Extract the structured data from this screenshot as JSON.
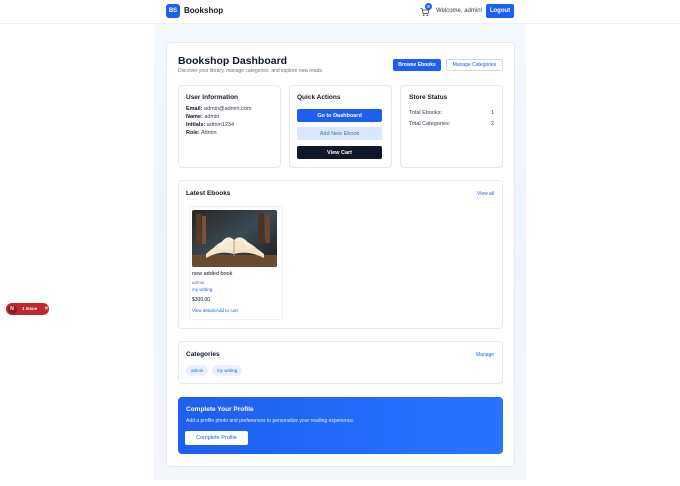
{
  "navbar": {
    "logo_text": "BS",
    "brand": "Bookshop",
    "cart_count": "0",
    "welcome": "Welcome, admin!",
    "logout": "Logout"
  },
  "header": {
    "title": "Bookshop Dashboard",
    "subtitle": "Discover your library, manage categories, and explore new reads.",
    "browse_button": "Browse Ebooks",
    "manage_button": "Manage Categories"
  },
  "user_info": {
    "title": "User Information",
    "rows": [
      {
        "label": "Email:",
        "value": "admin@admin.com"
      },
      {
        "label": "Name:",
        "value": "admin"
      },
      {
        "label": "Initials:",
        "value": "admin1234"
      },
      {
        "label": "Role:",
        "value": "Admin"
      }
    ]
  },
  "quick_actions": {
    "title": "Quick Actions",
    "dashboard": "Go to Dashboard",
    "add_ebook": "Add New Ebook",
    "view_cart": "View Cart"
  },
  "store_status": {
    "title": "Store Status",
    "rows": [
      {
        "label": "Total Ebooks:",
        "value": "1"
      },
      {
        "label": "Total Categories:",
        "value": "2"
      }
    ]
  },
  "latest": {
    "title": "Latest Ebooks",
    "view_all": "View all",
    "book": {
      "name": "new added book",
      "author": "admin",
      "category": "my writing",
      "price": "$300.00",
      "view_details": "View details",
      "add_to_cart": "Add to cart"
    }
  },
  "categories": {
    "title": "Categories",
    "manage": "Manage",
    "items": [
      "admin",
      "my writing"
    ]
  },
  "promo": {
    "title": "Complete Your Profile",
    "text": "Add a profile photo and preferences to personalize your reading experience.",
    "button": "Complete Profile"
  },
  "issue_badge": {
    "avatar": "N",
    "text": "1 Issue",
    "close": "✕"
  },
  "colors": {
    "accent": "#1d5ff0",
    "dark_button": "#0f172a",
    "issue_red": "#c0262d"
  }
}
